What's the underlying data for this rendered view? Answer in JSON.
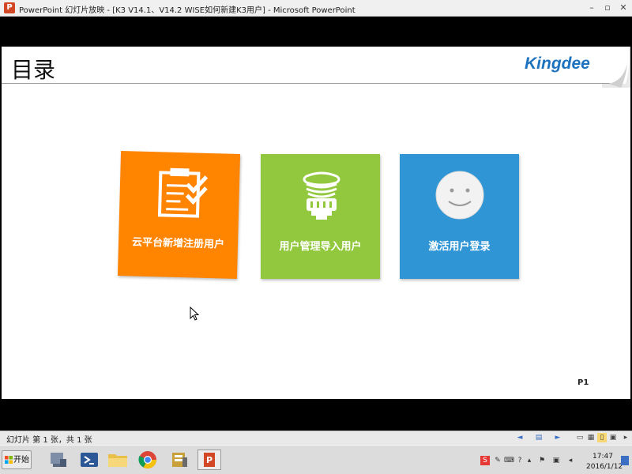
{
  "window": {
    "title": "PowerPoint 幻灯片放映 - [K3 V14.1、V14.2 WISE如何新建K3用户] - Microsoft PowerPoint",
    "app_icon_letter": "P",
    "minimize": "–",
    "restore": "▫",
    "close": "✕"
  },
  "slide": {
    "heading": "目录",
    "logo": "Kingdee",
    "page_number": "P1",
    "tiles": [
      {
        "label": "云平台新增注册用户",
        "icon": "clipboard-check-icon",
        "color": "#ff8400"
      },
      {
        "label": "用户管理导入用户",
        "icon": "lightbulb-icon",
        "color": "#92c83e"
      },
      {
        "label": "激活用户登录",
        "icon": "smiley-face-icon",
        "color": "#3095d5"
      }
    ]
  },
  "statusbar": {
    "slide_info": "幻灯片 第 1 张，共 1 张"
  },
  "taskbar": {
    "start_label": "开始",
    "time": "17:47",
    "date": "2016/1/12"
  }
}
